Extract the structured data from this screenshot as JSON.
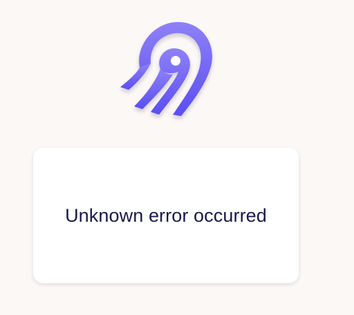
{
  "logo": {
    "icon": "airbyte-logo-icon",
    "gradient_top": "#8b7cf6",
    "gradient_bottom": "#5b4ff2"
  },
  "error": {
    "message": "Unknown error occurred"
  },
  "colors": {
    "background": "#fcf8f5",
    "card": "#ffffff",
    "text": "#1a194d"
  }
}
